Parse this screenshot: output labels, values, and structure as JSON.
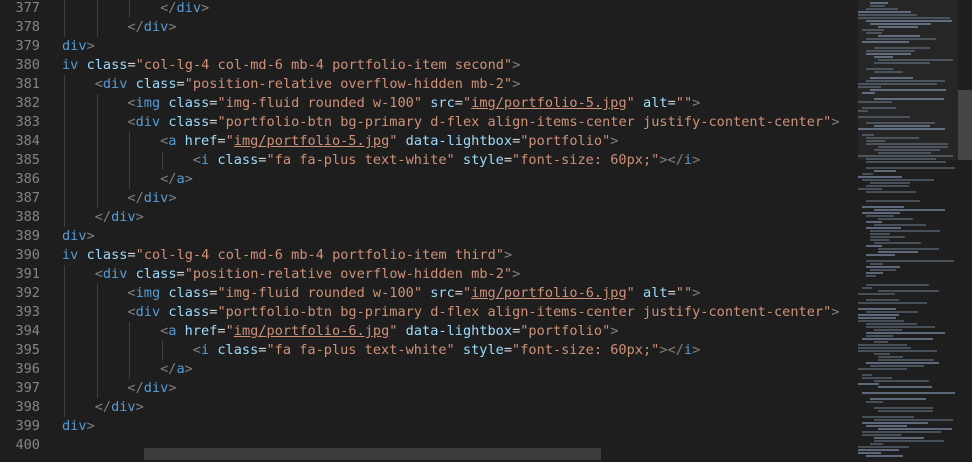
{
  "editor": {
    "lines": [
      {
        "n": "377",
        "indent": 3,
        "tokens": [
          [
            "pun",
            "</"
          ],
          [
            "tag",
            "div"
          ],
          [
            "pun",
            ">"
          ]
        ]
      },
      {
        "n": "378",
        "indent": 2,
        "tokens": [
          [
            "pun",
            "</"
          ],
          [
            "tag",
            "div"
          ],
          [
            "pun",
            ">"
          ]
        ]
      },
      {
        "n": "379",
        "indent": 0,
        "tokens": [
          [
            "tag",
            "div"
          ],
          [
            "pun",
            ">"
          ]
        ]
      },
      {
        "n": "380",
        "indent": 0,
        "tokens": [
          [
            "tag",
            "iv"
          ],
          [
            "plain",
            " "
          ],
          [
            "attr",
            "class"
          ],
          [
            "plain",
            "="
          ],
          [
            "str",
            "\"col-lg-4 col-md-6 mb-4 portfolio-item second\""
          ],
          [
            "pun",
            ">"
          ]
        ]
      },
      {
        "n": "381",
        "indent": 1,
        "tokens": [
          [
            "pun",
            "<"
          ],
          [
            "tag",
            "div"
          ],
          [
            "plain",
            " "
          ],
          [
            "attr",
            "class"
          ],
          [
            "plain",
            "="
          ],
          [
            "str",
            "\"position-relative overflow-hidden mb-2\""
          ],
          [
            "pun",
            ">"
          ]
        ]
      },
      {
        "n": "382",
        "indent": 2,
        "tokens": [
          [
            "pun",
            "<"
          ],
          [
            "tag",
            "img"
          ],
          [
            "plain",
            " "
          ],
          [
            "attr",
            "class"
          ],
          [
            "plain",
            "="
          ],
          [
            "str",
            "\"img-fluid rounded w-100\""
          ],
          [
            "plain",
            " "
          ],
          [
            "attr",
            "src"
          ],
          [
            "plain",
            "="
          ],
          [
            "str",
            "\""
          ],
          [
            "strlink",
            "img/portfolio-5.jpg"
          ],
          [
            "str",
            "\""
          ],
          [
            "plain",
            " "
          ],
          [
            "attr",
            "alt"
          ],
          [
            "plain",
            "="
          ],
          [
            "str",
            "\"\""
          ],
          [
            "pun",
            ">"
          ]
        ]
      },
      {
        "n": "383",
        "indent": 2,
        "tokens": [
          [
            "pun",
            "<"
          ],
          [
            "tag",
            "div"
          ],
          [
            "plain",
            " "
          ],
          [
            "attr",
            "class"
          ],
          [
            "plain",
            "="
          ],
          [
            "str",
            "\"portfolio-btn bg-primary d-flex align-items-center justify-content-center\""
          ],
          [
            "pun",
            ">"
          ]
        ]
      },
      {
        "n": "384",
        "indent": 3,
        "tokens": [
          [
            "pun",
            "<"
          ],
          [
            "tag",
            "a"
          ],
          [
            "plain",
            " "
          ],
          [
            "attr",
            "href"
          ],
          [
            "plain",
            "="
          ],
          [
            "str",
            "\""
          ],
          [
            "strlink",
            "img/portfolio-5.jpg"
          ],
          [
            "str",
            "\""
          ],
          [
            "plain",
            " "
          ],
          [
            "attr",
            "data-lightbox"
          ],
          [
            "plain",
            "="
          ],
          [
            "str",
            "\"portfolio\""
          ],
          [
            "pun",
            ">"
          ]
        ]
      },
      {
        "n": "385",
        "indent": 4,
        "tokens": [
          [
            "pun",
            "<"
          ],
          [
            "tag",
            "i"
          ],
          [
            "plain",
            " "
          ],
          [
            "attr",
            "class"
          ],
          [
            "plain",
            "="
          ],
          [
            "str",
            "\"fa fa-plus text-white\""
          ],
          [
            "plain",
            " "
          ],
          [
            "attr",
            "style"
          ],
          [
            "plain",
            "="
          ],
          [
            "str",
            "\"font-size: 60px;\""
          ],
          [
            "pun",
            "></"
          ],
          [
            "tag",
            "i"
          ],
          [
            "pun",
            ">"
          ]
        ]
      },
      {
        "n": "386",
        "indent": 3,
        "tokens": [
          [
            "pun",
            "</"
          ],
          [
            "tag",
            "a"
          ],
          [
            "pun",
            ">"
          ]
        ]
      },
      {
        "n": "387",
        "indent": 2,
        "tokens": [
          [
            "pun",
            "</"
          ],
          [
            "tag",
            "div"
          ],
          [
            "pun",
            ">"
          ]
        ]
      },
      {
        "n": "388",
        "indent": 1,
        "tokens": [
          [
            "pun",
            "</"
          ],
          [
            "tag",
            "div"
          ],
          [
            "pun",
            ">"
          ]
        ]
      },
      {
        "n": "389",
        "indent": 0,
        "tokens": [
          [
            "tag",
            "div"
          ],
          [
            "pun",
            ">"
          ]
        ]
      },
      {
        "n": "390",
        "indent": 0,
        "tokens": [
          [
            "tag",
            "iv"
          ],
          [
            "plain",
            " "
          ],
          [
            "attr",
            "class"
          ],
          [
            "plain",
            "="
          ],
          [
            "str",
            "\"col-lg-4 col-md-6 mb-4 portfolio-item third\""
          ],
          [
            "pun",
            ">"
          ]
        ]
      },
      {
        "n": "391",
        "indent": 1,
        "tokens": [
          [
            "pun",
            "<"
          ],
          [
            "tag",
            "div"
          ],
          [
            "plain",
            " "
          ],
          [
            "attr",
            "class"
          ],
          [
            "plain",
            "="
          ],
          [
            "str",
            "\"position-relative overflow-hidden mb-2\""
          ],
          [
            "pun",
            ">"
          ]
        ]
      },
      {
        "n": "392",
        "indent": 2,
        "tokens": [
          [
            "pun",
            "<"
          ],
          [
            "tag",
            "img"
          ],
          [
            "plain",
            " "
          ],
          [
            "attr",
            "class"
          ],
          [
            "plain",
            "="
          ],
          [
            "str",
            "\"img-fluid rounded w-100\""
          ],
          [
            "plain",
            " "
          ],
          [
            "attr",
            "src"
          ],
          [
            "plain",
            "="
          ],
          [
            "str",
            "\""
          ],
          [
            "strlink",
            "img/portfolio-6.jpg"
          ],
          [
            "str",
            "\""
          ],
          [
            "plain",
            " "
          ],
          [
            "attr",
            "alt"
          ],
          [
            "plain",
            "="
          ],
          [
            "str",
            "\"\""
          ],
          [
            "pun",
            ">"
          ]
        ]
      },
      {
        "n": "393",
        "indent": 2,
        "tokens": [
          [
            "pun",
            "<"
          ],
          [
            "tag",
            "div"
          ],
          [
            "plain",
            " "
          ],
          [
            "attr",
            "class"
          ],
          [
            "plain",
            "="
          ],
          [
            "str",
            "\"portfolio-btn bg-primary d-flex align-items-center justify-content-center\""
          ],
          [
            "pun",
            ">"
          ]
        ]
      },
      {
        "n": "394",
        "indent": 3,
        "tokens": [
          [
            "pun",
            "<"
          ],
          [
            "tag",
            "a"
          ],
          [
            "plain",
            " "
          ],
          [
            "attr",
            "href"
          ],
          [
            "plain",
            "="
          ],
          [
            "str",
            "\""
          ],
          [
            "strlink",
            "img/portfolio-6.jpg"
          ],
          [
            "str",
            "\""
          ],
          [
            "plain",
            " "
          ],
          [
            "attr",
            "data-lightbox"
          ],
          [
            "plain",
            "="
          ],
          [
            "str",
            "\"portfolio\""
          ],
          [
            "pun",
            ">"
          ]
        ]
      },
      {
        "n": "395",
        "indent": 4,
        "tokens": [
          [
            "pun",
            "<"
          ],
          [
            "tag",
            "i"
          ],
          [
            "plain",
            " "
          ],
          [
            "attr",
            "class"
          ],
          [
            "plain",
            "="
          ],
          [
            "str",
            "\"fa fa-plus text-white\""
          ],
          [
            "plain",
            " "
          ],
          [
            "attr",
            "style"
          ],
          [
            "plain",
            "="
          ],
          [
            "str",
            "\"font-size: 60px;\""
          ],
          [
            "pun",
            "></"
          ],
          [
            "tag",
            "i"
          ],
          [
            "pun",
            ">"
          ]
        ]
      },
      {
        "n": "396",
        "indent": 3,
        "tokens": [
          [
            "pun",
            "</"
          ],
          [
            "tag",
            "a"
          ],
          [
            "pun",
            ">"
          ]
        ]
      },
      {
        "n": "397",
        "indent": 2,
        "tokens": [
          [
            "pun",
            "</"
          ],
          [
            "tag",
            "div"
          ],
          [
            "pun",
            ">"
          ]
        ]
      },
      {
        "n": "398",
        "indent": 1,
        "tokens": [
          [
            "pun",
            "</"
          ],
          [
            "tag",
            "div"
          ],
          [
            "pun",
            ">"
          ]
        ]
      },
      {
        "n": "399",
        "indent": 0,
        "tokens": [
          [
            "tag",
            "div"
          ],
          [
            "pun",
            ">"
          ]
        ]
      },
      {
        "n": "400",
        "indent": 0,
        "tokens": []
      }
    ]
  },
  "colors": {
    "background": "#1e1e1e",
    "tag": "#569cd6",
    "attribute": "#9cdcfe",
    "string": "#ce9178",
    "punctuation": "#808080",
    "line_number": "#858585"
  }
}
